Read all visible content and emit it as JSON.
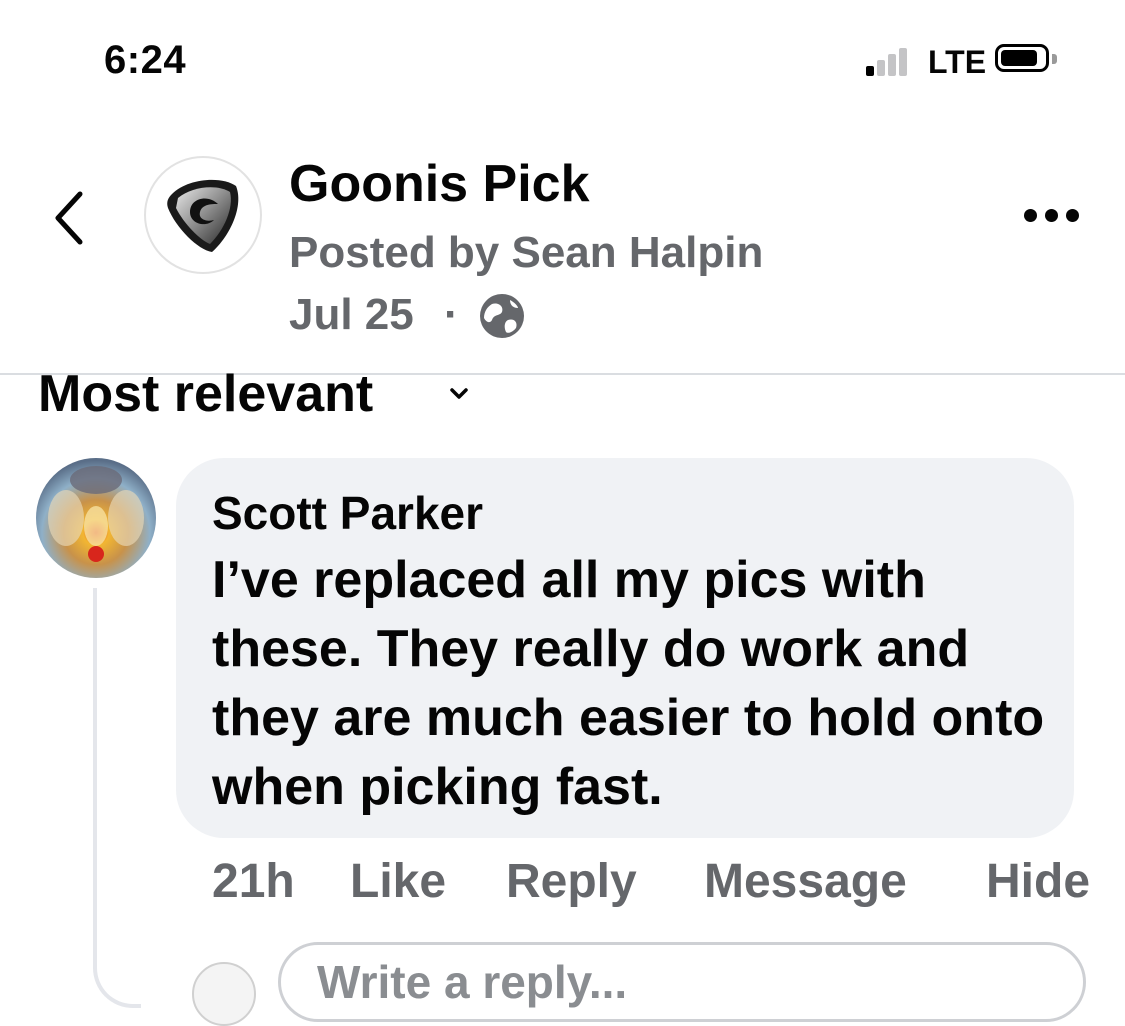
{
  "status_bar": {
    "time": "6:24",
    "network": "LTE",
    "signal_bars_active": 1,
    "signal_bars_total": 4
  },
  "header": {
    "group_name": "Goonis Pick",
    "posted_by": "Posted by Sean Halpin",
    "date": "Jul 25",
    "separator": "·",
    "privacy_icon": "globe-icon",
    "back_icon": "chevron-left-icon",
    "more_icon": "more-horizontal-icon"
  },
  "sort": {
    "label": "Most relevant",
    "icon": "chevron-down-icon"
  },
  "comment": {
    "author": "Scott Parker",
    "text": "I’ve replaced all my pics with these. They really do work and they are much easier to hold onto when picking fast.",
    "time": "21h",
    "actions": {
      "like": "Like",
      "reply": "Reply",
      "message": "Message",
      "hide": "Hide"
    }
  },
  "reply_box": {
    "placeholder": "Write a reply..."
  },
  "colors": {
    "text_primary": "#050505",
    "text_secondary": "#65676b",
    "bubble_bg": "#f0f2f5",
    "divider": "#dadde1"
  }
}
